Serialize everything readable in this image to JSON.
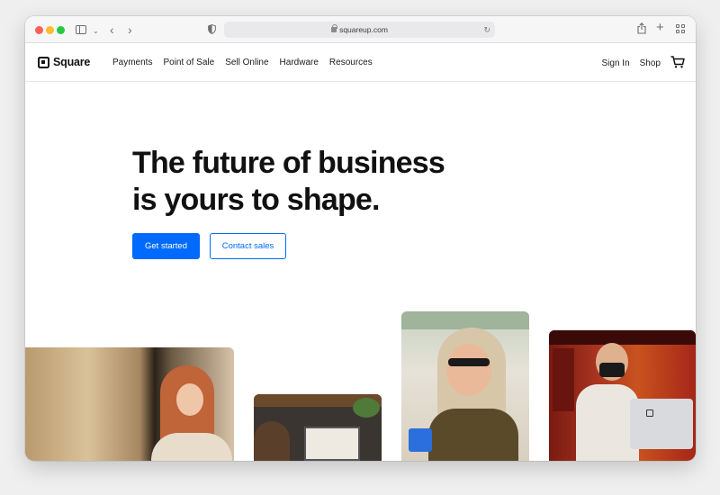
{
  "browser": {
    "url": "squareup.com",
    "icons": {
      "sidebar": "sidebar-icon",
      "back": "chevron-left-icon",
      "forward": "chevron-right-icon",
      "shield": "shield-icon",
      "lock": "lock-icon",
      "reload": "reload-icon",
      "share": "share-icon",
      "new_tab": "plus-icon",
      "tabs_overview": "grid-icon"
    }
  },
  "nav": {
    "brand": "Square",
    "links": [
      "Payments",
      "Point of Sale",
      "Sell Online",
      "Hardware",
      "Resources"
    ],
    "sign_in": "Sign In",
    "shop": "Shop",
    "cart_icon": "cart-icon"
  },
  "hero": {
    "title_line1": "The future of business",
    "title_line2": "is yours to shape.",
    "primary_cta": "Get started",
    "secondary_cta": "Contact sales"
  },
  "colors": {
    "brand_blue": "#006aff",
    "text": "#111111"
  }
}
